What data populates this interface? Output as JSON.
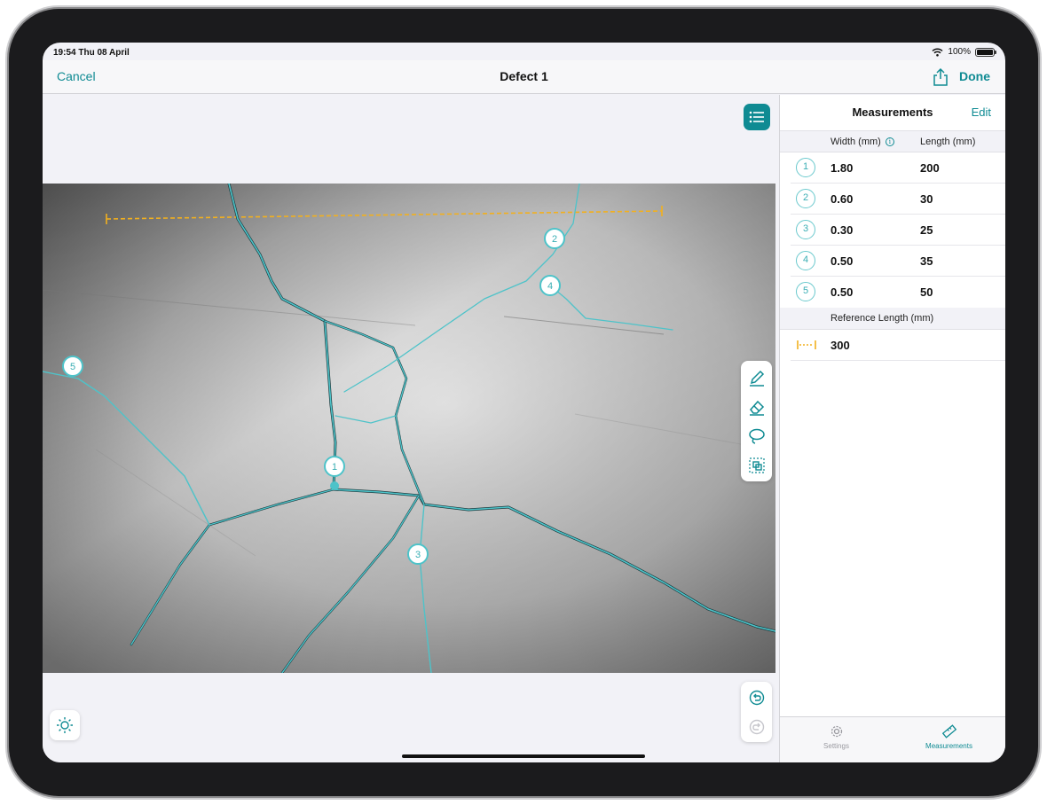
{
  "status_bar": {
    "time": "19:54  Thu 08 April",
    "battery": "100%"
  },
  "navbar": {
    "cancel": "Cancel",
    "title": "Defect 1",
    "done": "Done"
  },
  "measurements_panel": {
    "title": "Measurements",
    "edit": "Edit",
    "col_width": "Width (mm)",
    "col_length": "Length (mm)",
    "rows": [
      {
        "id": "1",
        "width": "1.80",
        "length": "200"
      },
      {
        "id": "2",
        "width": "0.60",
        "length": "30"
      },
      {
        "id": "3",
        "width": "0.30",
        "length": "25"
      },
      {
        "id": "4",
        "width": "0.50",
        "length": "35"
      },
      {
        "id": "5",
        "width": "0.50",
        "length": "50"
      }
    ],
    "reference_label": "Reference Length (mm)",
    "reference_value": "300"
  },
  "canvas_markers": [
    "1",
    "2",
    "3",
    "4",
    "5"
  ],
  "tabbar": {
    "settings": "Settings",
    "measurements": "Measurements"
  },
  "colors": {
    "accent": "#0f8b93",
    "crack": "#4ec3c9",
    "reference": "#f2b01e"
  },
  "icons": [
    "wifi-icon",
    "battery-icon",
    "share-icon",
    "list-icon",
    "pencil-icon",
    "eraser-icon",
    "lasso-icon",
    "select-icon",
    "undo-icon",
    "redo-icon",
    "brightness-icon",
    "info-icon",
    "ruler-icon",
    "gear-icon"
  ]
}
